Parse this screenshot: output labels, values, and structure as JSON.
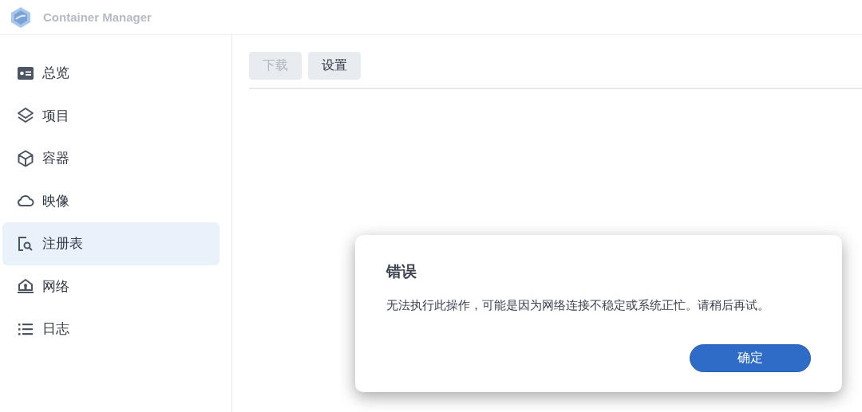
{
  "app": {
    "title": "Container Manager"
  },
  "sidebar": {
    "items": [
      {
        "label": "总览",
        "selected": false
      },
      {
        "label": "项目",
        "selected": false
      },
      {
        "label": "容器",
        "selected": false
      },
      {
        "label": "映像",
        "selected": false
      },
      {
        "label": "注册表",
        "selected": true
      },
      {
        "label": "网络",
        "selected": false
      },
      {
        "label": "日志",
        "selected": false
      }
    ]
  },
  "toolbar": {
    "buttons": [
      {
        "label": "下载",
        "disabled": true
      },
      {
        "label": "设置",
        "disabled": false
      }
    ]
  },
  "dialog": {
    "title": "错误",
    "message": "无法执行此操作，可能是因为网络连接不稳定或系统正忙。请稍后再试。",
    "button": "确定"
  }
}
